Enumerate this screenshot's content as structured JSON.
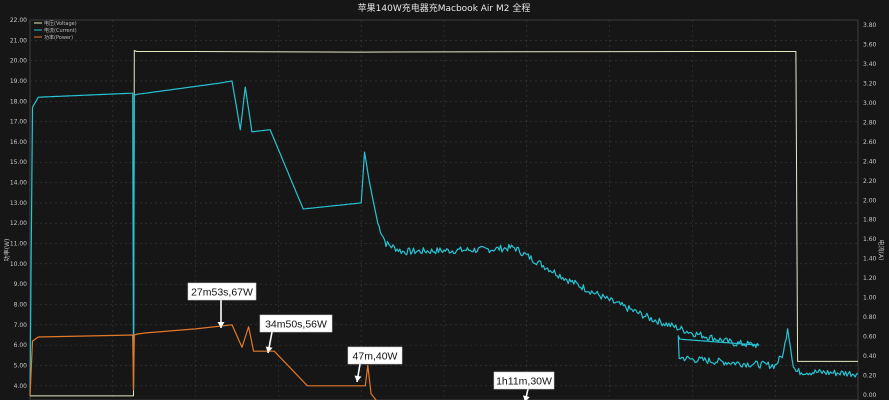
{
  "chart_data": {
    "type": "line",
    "title": "苹果140W充电器充Macbook Air M2 全程",
    "ylabel_left": "功率(W)",
    "ylabel_right": "电流(A)",
    "y_left_ticks": [
      "4.00",
      "5.00",
      "6.00",
      "7.00",
      "8.00",
      "9.00",
      "10.00",
      "11.00",
      "12.00",
      "13.00",
      "14.00",
      "15.00",
      "16.00",
      "17.00",
      "18.00",
      "19.00",
      "20.00",
      "21.00",
      "22.00"
    ],
    "y_left_range": [
      3.3,
      22.0
    ],
    "y_right_ticks": [
      "0.00",
      "0.20",
      "0.40",
      "0.60",
      "0.80",
      "1.00",
      "1.20",
      "1.40",
      "1.60",
      "1.80",
      "2.00",
      "2.20",
      "2.40",
      "2.60",
      "2.80",
      "3.00",
      "3.20",
      "3.40",
      "3.60",
      "3.80"
    ],
    "y_right_range": [
      -0.05,
      3.85
    ],
    "x_range": [
      0,
      100
    ],
    "legend_placement": "top-left",
    "colors": {
      "background": "#161616",
      "grid": "#3a3a3a",
      "voltage": "#e8e8c2",
      "current": "#27c3d3",
      "power": "#e2782a",
      "annotation_bg": "#ffffff"
    },
    "series": [
      {
        "name": "电压(Voltage)",
        "color": "#e8e8c2",
        "points": [
          [
            0,
            3.5
          ],
          [
            12.5,
            3.5
          ],
          [
            12.6,
            20.5
          ],
          [
            12.9,
            20.45
          ],
          [
            20,
            20.45
          ],
          [
            40,
            20.42
          ],
          [
            60,
            20.44
          ],
          [
            80,
            20.45
          ],
          [
            92.5,
            20.45
          ],
          [
            92.7,
            5.2
          ],
          [
            100,
            5.2
          ]
        ]
      },
      {
        "name": "电流(Current)",
        "color": "#27c3d3",
        "points": [
          [
            0,
            3.5
          ],
          [
            0.3,
            17.7
          ],
          [
            1,
            18.2
          ],
          [
            12.4,
            18.4
          ],
          [
            12.5,
            3.8
          ],
          [
            12.6,
            18.3
          ],
          [
            13,
            18.35
          ],
          [
            14,
            18.4
          ],
          [
            23,
            18.9
          ],
          [
            24.4,
            19.0
          ],
          [
            25.4,
            16.6
          ],
          [
            26,
            18.7
          ],
          [
            26.8,
            16.5
          ],
          [
            29,
            16.6
          ],
          [
            33,
            12.7
          ],
          [
            40,
            13.0
          ],
          [
            40.4,
            15.5
          ],
          [
            41,
            14.0
          ],
          [
            42,
            12.0
          ],
          [
            43,
            11.0
          ],
          [
            45,
            10.6
          ],
          [
            55,
            10.7
          ],
          [
            58.5,
            10.8
          ],
          [
            60,
            10.4
          ],
          [
            65,
            9.2
          ],
          [
            70,
            8.2
          ],
          [
            75,
            7.3
          ],
          [
            80,
            6.6
          ],
          [
            85,
            6.1
          ],
          [
            88,
            6.0
          ],
          [
            78.3,
            6.3
          ],
          [
            78.4,
            5.4
          ],
          [
            80,
            5.3
          ],
          [
            86,
            5.1
          ],
          [
            90,
            5.0
          ],
          [
            91,
            5.6
          ],
          [
            91.5,
            6.9
          ],
          [
            92.2,
            5.0
          ],
          [
            92.5,
            4.7
          ],
          [
            100,
            4.6
          ]
        ]
      },
      {
        "name": "功率(Power)",
        "color": "#e2782a",
        "points": [
          [
            0,
            3.5
          ],
          [
            0.3,
            6.2
          ],
          [
            1,
            6.4
          ],
          [
            12.4,
            6.5
          ],
          [
            12.5,
            3.8
          ],
          [
            12.6,
            6.5
          ],
          [
            13,
            6.55
          ],
          [
            14,
            6.6
          ],
          [
            20,
            6.8
          ],
          [
            24.4,
            7.0
          ],
          [
            25.6,
            5.9
          ],
          [
            26.4,
            6.9
          ],
          [
            27,
            5.7
          ],
          [
            28,
            5.7
          ],
          [
            29.5,
            5.7
          ],
          [
            33.5,
            4.0
          ],
          [
            38,
            4.0
          ],
          [
            40.5,
            4.0
          ],
          [
            40.8,
            5.0
          ],
          [
            41.2,
            3.6
          ],
          [
            41.8,
            3.3
          ]
        ]
      }
    ],
    "annotations": [
      {
        "label": "27m53s,67W"
      },
      {
        "label": "34m50s,56W"
      },
      {
        "label": "47m,40W"
      },
      {
        "label": "1h11m,30W"
      }
    ]
  }
}
